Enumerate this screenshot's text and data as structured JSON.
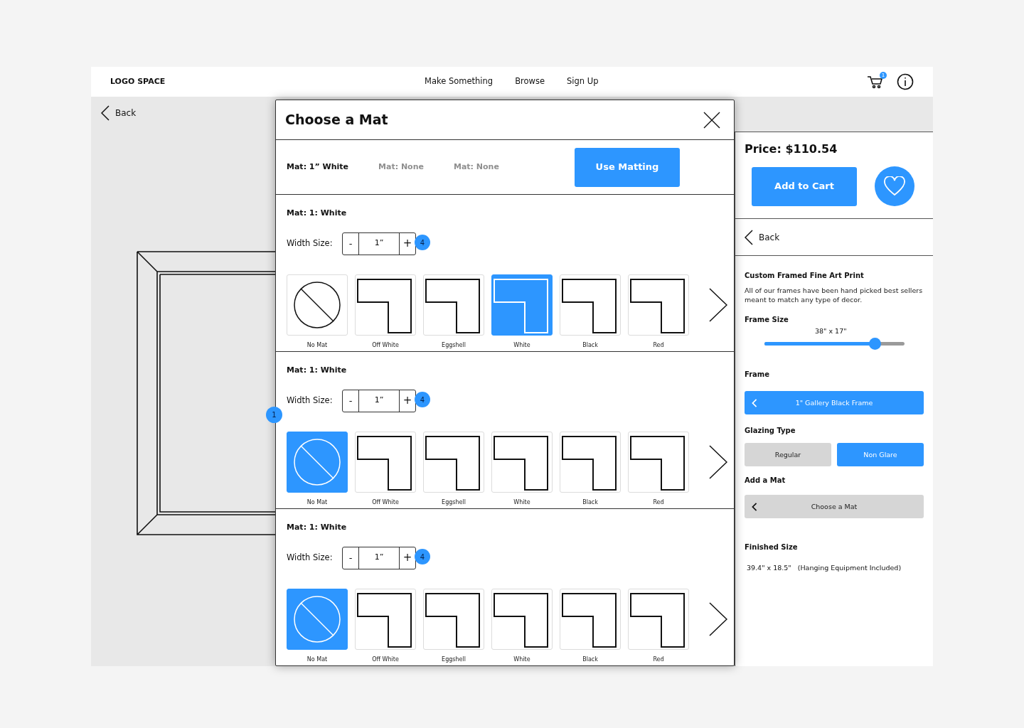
{
  "header": {
    "logo": "LOGO SPACE",
    "nav": [
      "Make Something",
      "Browse",
      "Sign Up"
    ],
    "cart_badge": "1"
  },
  "canvas": {
    "back": "Back",
    "annotation": "1"
  },
  "modal": {
    "title": "Choose a Mat",
    "mat_tabs": [
      {
        "label": "Mat: 1” White",
        "selected": true
      },
      {
        "label": "Mat: None",
        "selected": false
      },
      {
        "label": "Mat: None",
        "selected": false
      }
    ],
    "use_button": "Use Matting",
    "sections": [
      {
        "title": "Mat: 1: White",
        "width_label": "Width Size:",
        "minus": "-",
        "value": "1”",
        "plus": "+",
        "annotation": "4",
        "swatches": [
          {
            "kind": "none",
            "label": "No Mat",
            "selected": false
          },
          {
            "kind": "mat",
            "label": "Off White",
            "selected": false
          },
          {
            "kind": "mat",
            "label": "Eggshell",
            "selected": false
          },
          {
            "kind": "mat",
            "label": "White",
            "selected": true
          },
          {
            "kind": "mat",
            "label": "Black",
            "selected": false
          },
          {
            "kind": "mat",
            "label": "Red",
            "selected": false
          }
        ]
      },
      {
        "title": "Mat: 1: White",
        "width_label": "Width Size:",
        "minus": "-",
        "value": "1”",
        "plus": "+",
        "annotation": "4",
        "swatches": [
          {
            "kind": "none",
            "label": "No Mat",
            "selected": true
          },
          {
            "kind": "mat",
            "label": "Off White",
            "selected": false
          },
          {
            "kind": "mat",
            "label": "Eggshell",
            "selected": false
          },
          {
            "kind": "mat",
            "label": "White",
            "selected": false
          },
          {
            "kind": "mat",
            "label": "Black",
            "selected": false
          },
          {
            "kind": "mat",
            "label": "Red",
            "selected": false
          }
        ]
      },
      {
        "title": "Mat: 1: White",
        "width_label": "Width Size:",
        "minus": "-",
        "value": "1”",
        "plus": "+",
        "annotation": "4",
        "swatches": [
          {
            "kind": "none",
            "label": "No Mat",
            "selected": true
          },
          {
            "kind": "mat",
            "label": "Off White",
            "selected": false
          },
          {
            "kind": "mat",
            "label": "Eggshell",
            "selected": false
          },
          {
            "kind": "mat",
            "label": "White",
            "selected": false
          },
          {
            "kind": "mat",
            "label": "Black",
            "selected": false
          },
          {
            "kind": "mat",
            "label": "Red",
            "selected": false
          }
        ]
      }
    ]
  },
  "panel": {
    "price": "Price: $110.54",
    "add_to_cart": "Add to Cart",
    "back": "Back",
    "product_title": "Custom Framed Fine Art Print",
    "description": "All of our frames have been hand picked best sellers meant to match any type of decor.",
    "frame_size_label": "Frame Size",
    "frame_size_value": "38\" x 17\"",
    "frame_size_slider": {
      "level": 0.79
    },
    "frame_label": "Frame",
    "frame_button": "1\" Gallery Black Frame",
    "glazing_label": "Glazing Type",
    "glazing": [
      {
        "label": "Regular",
        "selected": false
      },
      {
        "label": "Non Glare",
        "selected": true
      }
    ],
    "mat_label": "Add a Mat",
    "mat_button": "Choose a Mat",
    "finished_label": "Finished Size",
    "finished_value": "39.4\" x 18.5\"   (Hanging Equipment Included)"
  }
}
